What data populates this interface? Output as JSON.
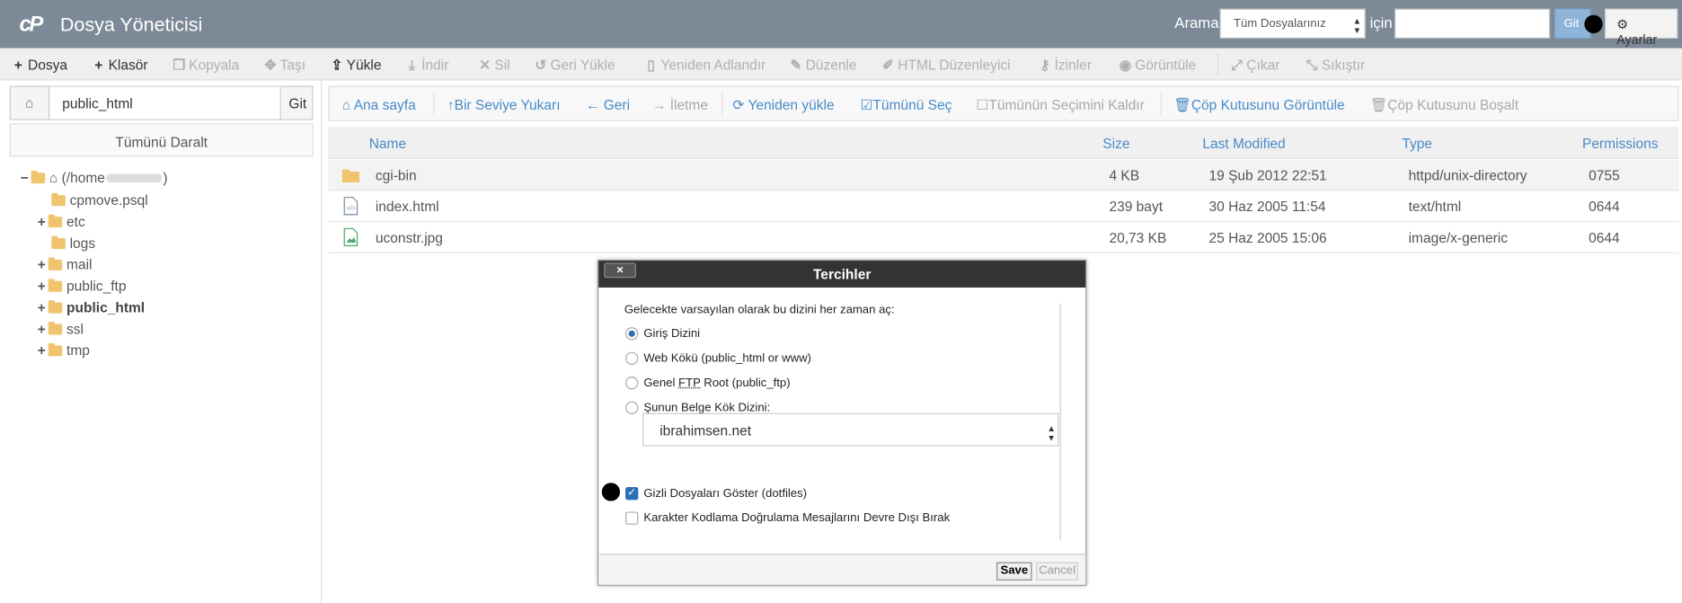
{
  "header": {
    "title": "Dosya Yöneticisi",
    "search_label": "Arama",
    "search_scope": "Tüm Dosyalarınız",
    "for_label": "için",
    "go_label": "Git",
    "settings_label": "Ayarlar"
  },
  "toolbar": {
    "items": [
      {
        "label": "Dosya",
        "icon": "plus-icon",
        "enabled": true
      },
      {
        "label": "Klasör",
        "icon": "plus-icon",
        "enabled": true
      },
      {
        "label": "Kopyala",
        "icon": "copy-icon",
        "enabled": false
      },
      {
        "label": "Taşı",
        "icon": "move-icon",
        "enabled": false
      },
      {
        "label": "Yükle",
        "icon": "upload-icon",
        "enabled": true
      },
      {
        "label": "İndir",
        "icon": "download-icon",
        "enabled": false
      },
      {
        "label": "Sil",
        "icon": "delete-icon",
        "enabled": false
      },
      {
        "label": "Geri Yükle",
        "icon": "restore-icon",
        "enabled": false
      },
      {
        "label": "Yeniden Adlandır",
        "icon": "file-icon",
        "enabled": false
      },
      {
        "label": "Düzenle",
        "icon": "pencil-icon",
        "enabled": false
      },
      {
        "label": "HTML Düzenleyici",
        "icon": "edit-icon",
        "enabled": false
      },
      {
        "label": "İzinler",
        "icon": "key-icon",
        "enabled": false
      },
      {
        "label": "Görüntüle",
        "icon": "eye-icon",
        "enabled": false
      },
      {
        "label": "Çıkar",
        "icon": "expand-icon",
        "enabled": false
      },
      {
        "label": "Sıkıştır",
        "icon": "compress-icon",
        "enabled": false
      }
    ]
  },
  "sidebar": {
    "path_value": "public_html",
    "go_label": "Git",
    "collapse_label": "Tümünü Daralt",
    "root_label_prefix": "(/home",
    "root_label_suffix": ")",
    "tree": [
      {
        "label": "cpmove.psql",
        "expandable": false,
        "bold": false
      },
      {
        "label": "etc",
        "expandable": true,
        "bold": false
      },
      {
        "label": "logs",
        "expandable": false,
        "bold": false
      },
      {
        "label": "mail",
        "expandable": true,
        "bold": false
      },
      {
        "label": "public_ftp",
        "expandable": true,
        "bold": false
      },
      {
        "label": "public_html",
        "expandable": true,
        "bold": true
      },
      {
        "label": "ssl",
        "expandable": true,
        "bold": false
      },
      {
        "label": "tmp",
        "expandable": true,
        "bold": false
      }
    ]
  },
  "nav": {
    "items": [
      {
        "label": "Ana sayfa",
        "icon": "home-icon",
        "enabled": true
      },
      {
        "label": "Bir Seviye Yukarı",
        "icon": "level-up-icon",
        "enabled": true
      },
      {
        "label": "Geri",
        "icon": "arrow-left-icon",
        "enabled": true
      },
      {
        "label": "İletme",
        "icon": "arrow-right-icon",
        "enabled": false
      },
      {
        "label": "Yeniden yükle",
        "icon": "refresh-icon",
        "enabled": true
      },
      {
        "label": "Tümünü Seç",
        "icon": "checkbox-checked-icon",
        "enabled": true
      },
      {
        "label": "Tümünün Seçimini Kaldır",
        "icon": "checkbox-empty-icon",
        "enabled": false
      },
      {
        "label": "Çöp Kutusunu Görüntüle",
        "icon": "trash-icon",
        "enabled": true
      },
      {
        "label": "Çöp Kutusunu Boşalt",
        "icon": "trash-icon",
        "enabled": false
      }
    ]
  },
  "table": {
    "columns": [
      "Name",
      "Size",
      "Last Modified",
      "Type",
      "Permissions"
    ],
    "rows": [
      {
        "icon": "folder-icon",
        "name": "cgi-bin",
        "size": "4 KB",
        "modified": "19 Şub 2012 22:51",
        "type": "httpd/unix-directory",
        "perms": "0755"
      },
      {
        "icon": "html-file-icon",
        "name": "index.html",
        "size": "239 bayt",
        "modified": "30 Haz 2005 11:54",
        "type": "text/html",
        "perms": "0644"
      },
      {
        "icon": "image-file-icon",
        "name": "uconstr.jpg",
        "size": "20,73 KB",
        "modified": "25 Haz 2005 15:06",
        "type": "image/x-generic",
        "perms": "0644"
      }
    ]
  },
  "dialog": {
    "title": "Tercihler",
    "close_label": "×",
    "intro": "Gelecekte varsayılan olarak bu dizini her zaman aç:",
    "options": [
      {
        "label": "Giriş Dizini",
        "selected": true
      },
      {
        "label": "Web Kökü (public_html or www)",
        "selected": false
      },
      {
        "label_pre": "Genel ",
        "label_abbr": "FTP",
        "label_post": " Root (public_ftp)",
        "selected": false
      },
      {
        "label": "Şunun Belge Kök Dizini:",
        "selected": false
      }
    ],
    "domain_value": "ibrahimsen.net",
    "checkboxes": [
      {
        "label": "Gizli Dosyaları Göster (dotfiles)",
        "checked": true
      },
      {
        "label": "Karakter Kodlama Doğrulama Mesajlarını Devre Dışı Bırak",
        "checked": false
      }
    ],
    "save_label": "Save",
    "cancel_label": "Cancel"
  },
  "colors": {
    "topbar": "#7c8a98",
    "accent": "#4a8bc8",
    "folder": "#f0c36d"
  }
}
